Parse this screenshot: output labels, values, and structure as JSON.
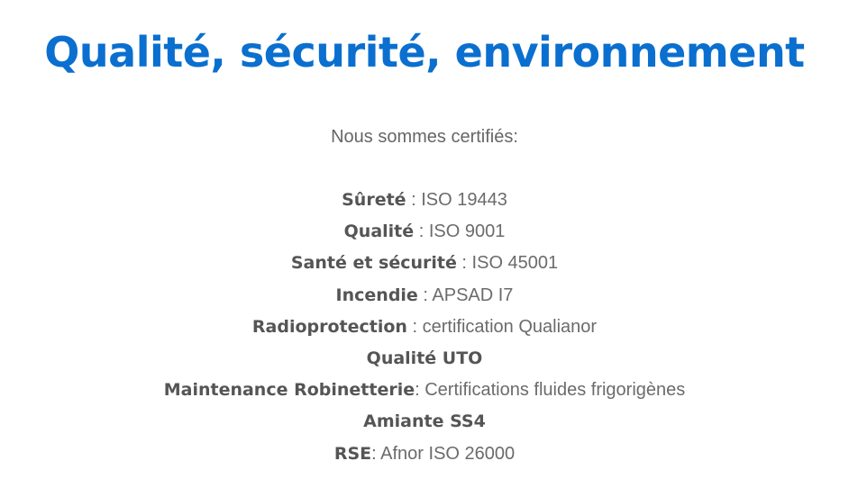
{
  "page": {
    "title": "Qualité, sécurité, environnement",
    "intro": "Nous sommes certifiés:"
  },
  "certifications": [
    {
      "name": "Sûreté",
      "detail": " : ISO 19443"
    },
    {
      "name": "Qualité",
      "detail": " : ISO 9001"
    },
    {
      "name": "Santé et sécurité",
      "detail": " : ISO 45001"
    },
    {
      "name": "Incendie",
      "detail": " : APSAD I7"
    },
    {
      "name": "Radioprotection",
      "detail": " : certification Qualianor"
    },
    {
      "name": "Qualité UTO",
      "detail": ""
    },
    {
      "name": "Maintenance Robinetterie",
      "detail": ": Certifications fluides frigorigènes"
    },
    {
      "name": "Amiante SS4",
      "detail": ""
    },
    {
      "name": "RSE",
      "detail": ": Afnor ISO 26000"
    }
  ],
  "colors": {
    "title": "#0a6fcf",
    "text": "#666666",
    "label": "#555555"
  }
}
